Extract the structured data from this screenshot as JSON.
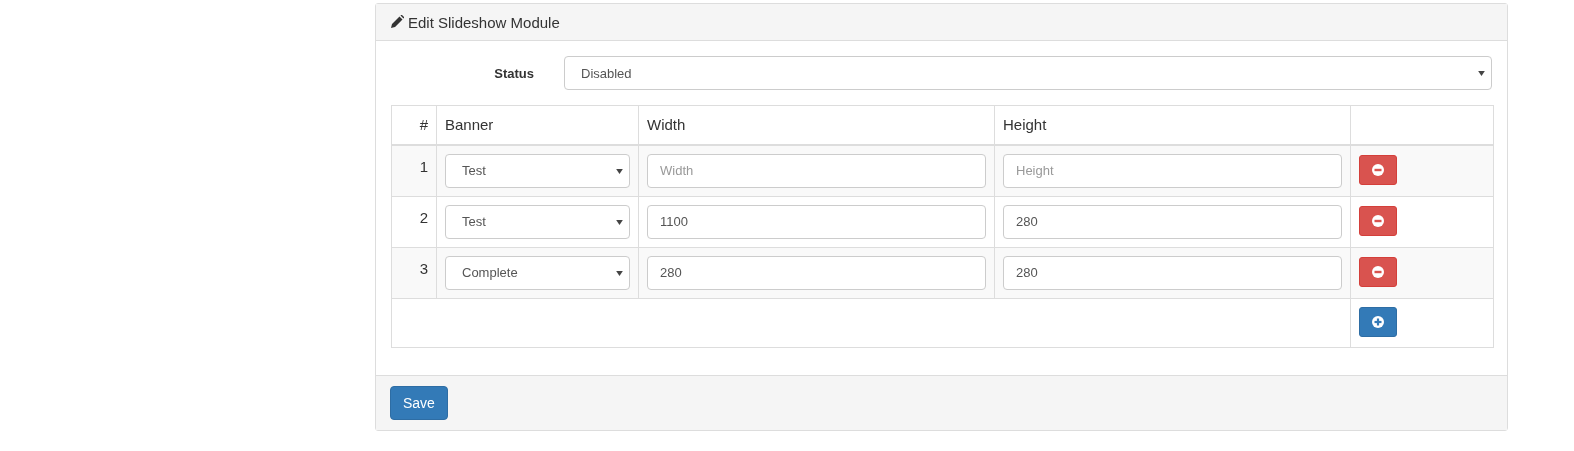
{
  "panel": {
    "title": "Edit Slideshow Module"
  },
  "status": {
    "label": "Status",
    "value": "Disabled"
  },
  "table": {
    "columns": [
      "#",
      "Banner",
      "Width",
      "Height"
    ],
    "rows": [
      {
        "number": "1",
        "banner": "Test",
        "width": {
          "placeholder": "Width"
        },
        "height": {
          "placeholder": "Height"
        }
      },
      {
        "number": "2",
        "banner": "Test",
        "width": {
          "value": "1100"
        },
        "height": {
          "value": "280"
        }
      },
      {
        "number": "3",
        "banner": "Complete",
        "width": {
          "value": "280"
        },
        "height": {
          "value": "280"
        }
      }
    ]
  },
  "buttons": [
    "Save"
  ]
}
